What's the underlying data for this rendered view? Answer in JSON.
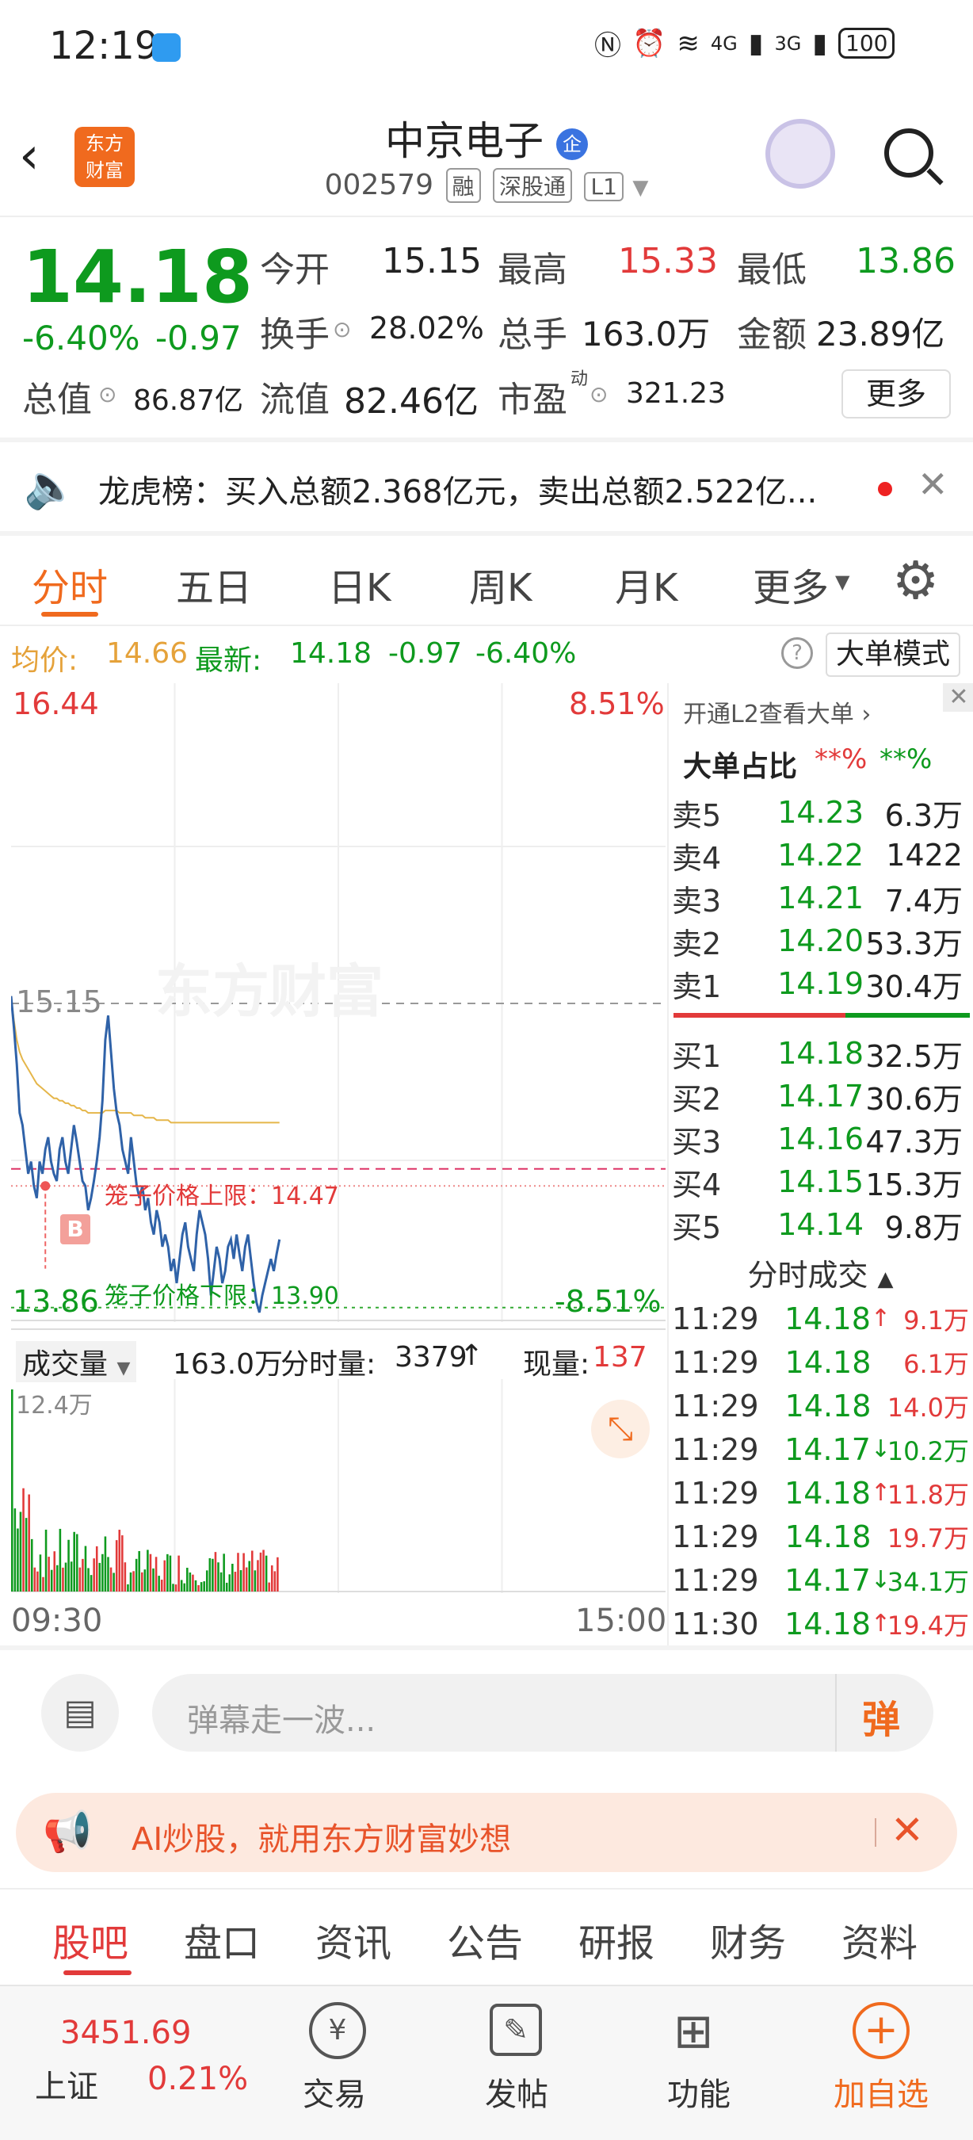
{
  "status": {
    "time": "12:19",
    "battery": "100",
    "net1": "4G",
    "net2": "3G"
  },
  "header": {
    "title": "中京电子",
    "badge": "企",
    "code": "002579",
    "tags": [
      "融",
      "深股通",
      "L1"
    ],
    "logo_line1": "东方",
    "logo_line2": "财富"
  },
  "quote": {
    "price": "14.18",
    "pct": "-6.40%",
    "chg": "-0.97",
    "open_label": "今开",
    "open": "15.15",
    "high_label": "最高",
    "high": "15.33",
    "low_label": "最低",
    "low": "13.86",
    "turnover_label": "换手",
    "turnover": "28.02%",
    "volume_label": "总手",
    "volume": "163.0万",
    "amount_label": "金额",
    "amount": "23.89亿",
    "mktcap_label": "总值",
    "mktcap": "86.87亿",
    "float_label": "流值",
    "float": "82.46亿",
    "pe_label": "市盈",
    "pe_sup": "动",
    "pe": "321.23",
    "more": "更多"
  },
  "notice": {
    "text": "龙虎榜：买入总额2.368亿元，卖出总额2.522亿..."
  },
  "tabs": [
    "分时",
    "五日",
    "日K",
    "周K",
    "月K",
    "更多"
  ],
  "infobar": {
    "avg_label": "均价:",
    "avg": "14.66",
    "latest_label": "最新:",
    "latest": "14.18",
    "chg": "-0.97",
    "pct": "-6.40%",
    "mode": "大单模式"
  },
  "chart": {
    "y_top": "16.44",
    "y_bottom": "13.86",
    "pct_top": "8.51%",
    "pct_bottom": "-8.51%",
    "ref": "15.15",
    "cage_up": "笼子价格上限：14.47",
    "cage_down": "笼子价格下限：13.90",
    "watermark": "东方财富",
    "marker": "B",
    "vol_label": "成交量",
    "vol_total": "163.0万",
    "vol_tick_label": "分时量:",
    "vol_tick": "3379",
    "vol_now_label": "现量:",
    "vol_now": "137",
    "vol_max": "12.4万",
    "time_start": "09:30",
    "time_end": "15:00"
  },
  "chart_data": {
    "type": "line",
    "x_range": [
      "09:30",
      "15:00"
    ],
    "ylim": [
      13.86,
      16.44
    ],
    "reference": 15.15,
    "price": [
      15.18,
      15.05,
      14.9,
      14.7,
      14.65,
      14.55,
      14.45,
      14.5,
      14.4,
      14.35,
      14.5,
      14.45,
      14.55,
      14.6,
      14.5,
      14.45,
      14.42,
      14.55,
      14.6,
      14.5,
      14.45,
      14.55,
      14.65,
      14.58,
      14.5,
      14.42,
      14.4,
      14.3,
      14.35,
      14.42,
      14.5,
      14.6,
      14.75,
      15.0,
      15.1,
      14.95,
      14.8,
      14.7,
      14.65,
      14.55,
      14.5,
      14.45,
      14.6,
      14.5,
      14.4,
      14.35,
      14.4,
      14.3,
      14.35,
      14.25,
      14.2,
      14.3,
      14.25,
      14.15,
      14.2,
      14.15,
      14.05,
      14.1,
      14.0,
      14.1,
      14.2,
      14.25,
      14.15,
      14.1,
      14.05,
      14.2,
      14.3,
      14.25,
      14.2,
      14.1,
      13.95,
      14.05,
      14.15,
      14.1,
      14.0,
      14.05,
      14.15,
      14.18,
      14.1,
      14.2,
      14.12,
      14.05,
      14.15,
      14.2,
      14.1,
      14.0,
      13.92,
      13.88,
      13.95,
      14.0,
      14.05,
      14.1,
      14.05,
      14.12,
      14.18
    ],
    "average": [
      15.18,
      15.08,
      15.0,
      14.95,
      14.92,
      14.9,
      14.88,
      14.86,
      14.84,
      14.82,
      14.81,
      14.8,
      14.79,
      14.78,
      14.77,
      14.76,
      14.76,
      14.75,
      14.75,
      14.74,
      14.74,
      14.73,
      14.73,
      14.72,
      14.72,
      14.71,
      14.71,
      14.7,
      14.7,
      14.7,
      14.7,
      14.7,
      14.7,
      14.71,
      14.71,
      14.71,
      14.71,
      14.71,
      14.7,
      14.7,
      14.7,
      14.7,
      14.7,
      14.69,
      14.69,
      14.69,
      14.69,
      14.68,
      14.68,
      14.68,
      14.68,
      14.67,
      14.67,
      14.67,
      14.67,
      14.67,
      14.66,
      14.66,
      14.66,
      14.66,
      14.66,
      14.66,
      14.66,
      14.66,
      14.66,
      14.66,
      14.66,
      14.66,
      14.66,
      14.66,
      14.66,
      14.66,
      14.66,
      14.66,
      14.66,
      14.66,
      14.66,
      14.66,
      14.66,
      14.66,
      14.66,
      14.66,
      14.66,
      14.66,
      14.66,
      14.66,
      14.66,
      14.66,
      14.66,
      14.66,
      14.66,
      14.66,
      14.66,
      14.66,
      14.66
    ]
  },
  "orderbook": {
    "title": "开通L2查看大单",
    "ratio_label": "大单占比",
    "ratio_sell": "**%",
    "ratio_buy": "**%",
    "asks": [
      {
        "label": "卖5",
        "price": "14.23",
        "vol": "6.3万"
      },
      {
        "label": "卖4",
        "price": "14.22",
        "vol": "1422"
      },
      {
        "label": "卖3",
        "price": "14.21",
        "vol": "7.4万"
      },
      {
        "label": "卖2",
        "price": "14.20",
        "vol": "53.3万"
      },
      {
        "label": "卖1",
        "price": "14.19",
        "vol": "30.4万"
      }
    ],
    "bids": [
      {
        "label": "买1",
        "price": "14.18",
        "vol": "32.5万"
      },
      {
        "label": "买2",
        "price": "14.17",
        "vol": "30.6万"
      },
      {
        "label": "买3",
        "price": "14.16",
        "vol": "47.3万"
      },
      {
        "label": "买4",
        "price": "14.15",
        "vol": "15.3万"
      },
      {
        "label": "买5",
        "price": "14.14",
        "vol": "9.8万"
      }
    ]
  },
  "ticks": {
    "title": "分时成交",
    "rows": [
      {
        "time": "11:29",
        "price": "14.18",
        "arrow": "↑",
        "vol": "9.1万",
        "pc": "green",
        "vc": "red"
      },
      {
        "time": "11:29",
        "price": "14.18",
        "arrow": "",
        "vol": "6.1万",
        "pc": "green",
        "vc": "red"
      },
      {
        "time": "11:29",
        "price": "14.18",
        "arrow": "",
        "vol": "14.0万",
        "pc": "green",
        "vc": "red"
      },
      {
        "time": "11:29",
        "price": "14.17",
        "arrow": "↓",
        "vol": "10.2万",
        "pc": "green",
        "vc": "green"
      },
      {
        "time": "11:29",
        "price": "14.18",
        "arrow": "↑",
        "vol": "11.8万",
        "pc": "green",
        "vc": "red"
      },
      {
        "time": "11:29",
        "price": "14.18",
        "arrow": "",
        "vol": "19.7万",
        "pc": "green",
        "vc": "red"
      },
      {
        "time": "11:29",
        "price": "14.17",
        "arrow": "↓",
        "vol": "34.1万",
        "pc": "green",
        "vc": "green"
      },
      {
        "time": "11:30",
        "price": "14.18",
        "arrow": "↑",
        "vol": "19.4万",
        "pc": "green",
        "vc": "red"
      }
    ]
  },
  "comment": {
    "placeholder": "弹幕走一波...",
    "danmu": "弹"
  },
  "banner": {
    "text": "AI炒股，就用东方财富妙想"
  },
  "bottom_tabs": [
    "股吧",
    "盘口",
    "资讯",
    "公告",
    "研报",
    "财务",
    "资料"
  ],
  "nav": {
    "index_value": "3451.69",
    "index_name": "上证",
    "index_pct": "0.21%",
    "trade": "交易",
    "post": "发帖",
    "func": "功能",
    "watch": "加自选"
  },
  "colors": {
    "red": "#e23a3a",
    "green": "#0e9a1e",
    "orange": "#f06a1e",
    "avg": "#e5b64a",
    "line": "#2f62a8"
  }
}
